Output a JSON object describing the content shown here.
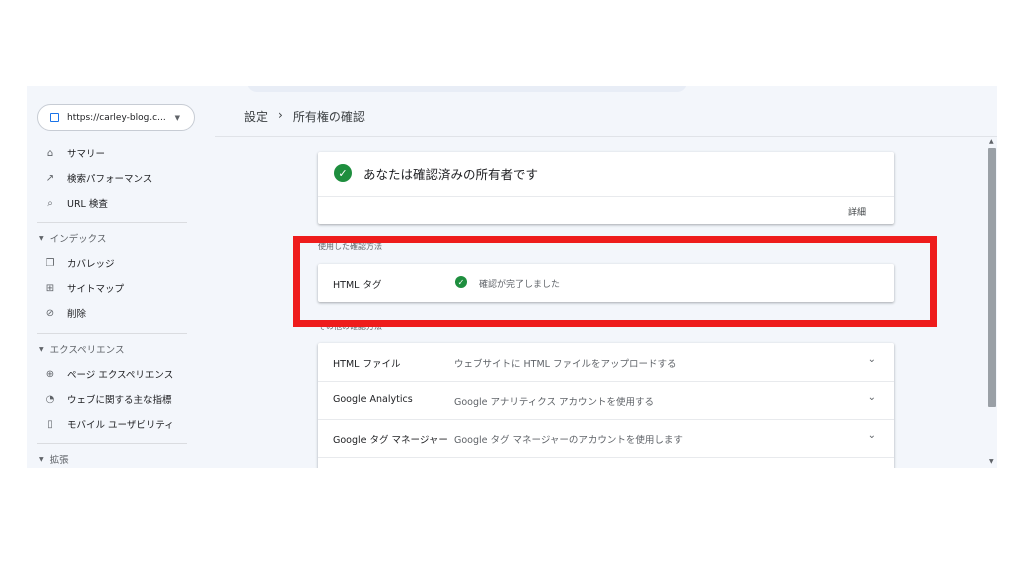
{
  "property": {
    "url": "https://carley-blog.c...",
    "caret": "▼"
  },
  "sidebar": {
    "items_top": [
      {
        "label": "サマリー",
        "icon": "home-icon"
      },
      {
        "label": "検索パフォーマンス",
        "icon": "trending-icon"
      },
      {
        "label": "URL 検査",
        "icon": "search-icon"
      }
    ],
    "sections": [
      {
        "title": "インデックス",
        "items": [
          {
            "label": "カバレッジ",
            "icon": "copy-icon"
          },
          {
            "label": "サイトマップ",
            "icon": "sitemap-icon"
          },
          {
            "label": "削除",
            "icon": "eye-off-icon"
          }
        ]
      },
      {
        "title": "エクスペリエンス",
        "items": [
          {
            "label": "ページ エクスペリエンス",
            "icon": "plus-circle-icon"
          },
          {
            "label": "ウェブに関する主な指標",
            "icon": "gauge-icon"
          },
          {
            "label": "モバイル ユーザビリティ",
            "icon": "phone-icon"
          }
        ]
      },
      {
        "title": "拡張",
        "items": []
      }
    ]
  },
  "breadcrumb": {
    "parent": "設定",
    "sep": "›",
    "current": "所有権の確認"
  },
  "owner_card": {
    "title": "あなたは確認済みの所有者です",
    "details": "詳細"
  },
  "used_method": {
    "heading": "使用した確認方法",
    "name": "HTML タグ",
    "status": "確認が完了しました"
  },
  "other_methods": {
    "heading": "その他の確認方法",
    "items": [
      {
        "name": "HTML ファイル",
        "desc": "ウェブサイトに HTML ファイルをアップロードする"
      },
      {
        "name": "Google Analytics",
        "desc": "Google アナリティクス アカウントを使用する"
      },
      {
        "name": "Google タグ マネージャー",
        "desc": "Google タグ マネージャーのアカウントを使用します"
      }
    ]
  },
  "colors": {
    "highlight": "#ee1c1c",
    "success": "#1e8e3e",
    "accent": "#1a73e8"
  }
}
